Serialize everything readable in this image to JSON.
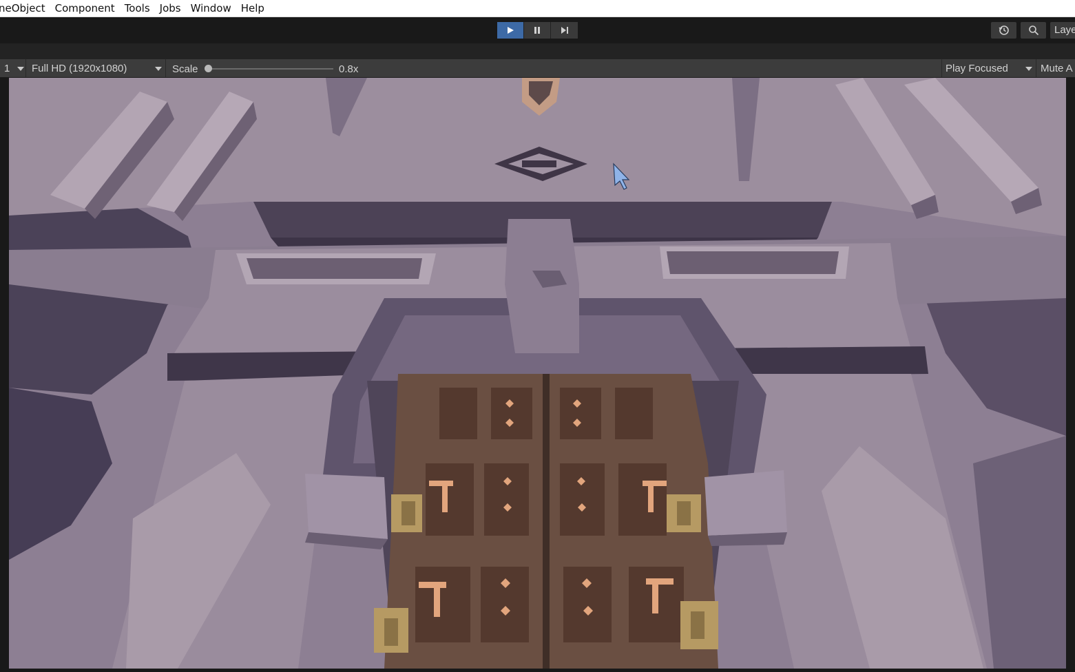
{
  "menubar": {
    "items": [
      "neObject",
      "Component",
      "Tools",
      "Jobs",
      "Window",
      "Help"
    ]
  },
  "toolbar": {
    "play_icon": "play-icon",
    "pause_icon": "pause-icon",
    "step_icon": "step-icon",
    "history_icon": "history-icon",
    "search_icon": "search-icon",
    "layers_label": "Laye",
    "accent_color": "#3d6aa6"
  },
  "game_view_bar": {
    "display_value": "1",
    "resolution_value": "Full HD (1920x1080)",
    "scale_label": "Scale",
    "scale_value": "0.8x",
    "play_mode_value": "Play Focused",
    "mute_label": "Mute A"
  },
  "viewport": {
    "scene": "Low-poly stone temple facade with a wooden double door, viewed in Game view",
    "cursor_icon": "mouse-cursor-icon"
  }
}
